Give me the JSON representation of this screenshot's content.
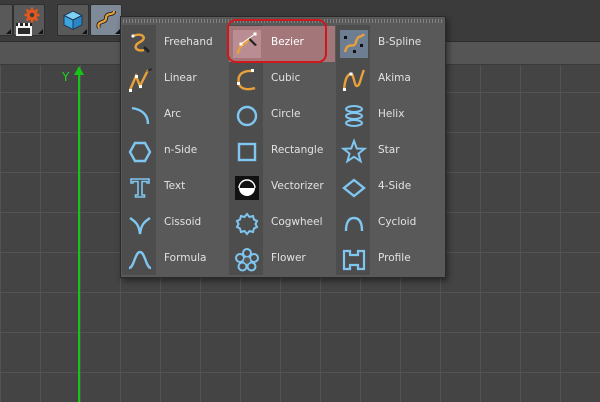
{
  "toolbar": {
    "buttons": [
      {
        "name": "object-tools",
        "icon": "gear-icon"
      },
      {
        "name": "render-settings",
        "icon": "clapperboard-icon"
      },
      {
        "name": "cube-object",
        "icon": "cube-icon"
      },
      {
        "name": "spline-tools",
        "icon": "spline-icon"
      }
    ]
  },
  "viewport": {
    "axis_label": "Y"
  },
  "spline_menu": {
    "highlight_color": "#d0181c",
    "selected_color": "#a3767a",
    "columns": [
      [
        {
          "label": "Freehand",
          "icon": "freehand-icon"
        },
        {
          "label": "Linear",
          "icon": "linear-icon"
        },
        {
          "label": "Arc",
          "icon": "arc-icon"
        },
        {
          "label": "n-Side",
          "icon": "hexagon-icon"
        },
        {
          "label": "Text",
          "icon": "text-icon"
        },
        {
          "label": "Cissoid",
          "icon": "cissoid-icon"
        },
        {
          "label": "Formula",
          "icon": "formula-icon"
        }
      ],
      [
        {
          "label": "Bezier",
          "icon": "bezier-icon",
          "selected": true
        },
        {
          "label": "Cubic",
          "icon": "cubic-icon"
        },
        {
          "label": "Circle",
          "icon": "circle-icon"
        },
        {
          "label": "Rectangle",
          "icon": "rectangle-icon"
        },
        {
          "label": "Vectorizer",
          "icon": "vectorizer-icon"
        },
        {
          "label": "Cogwheel",
          "icon": "cogwheel-icon"
        },
        {
          "label": "Flower",
          "icon": "flower-icon"
        }
      ],
      [
        {
          "label": "B-Spline",
          "icon": "bspline-icon"
        },
        {
          "label": "Akima",
          "icon": "akima-icon"
        },
        {
          "label": "Helix",
          "icon": "helix-icon"
        },
        {
          "label": "Star",
          "icon": "star-icon"
        },
        {
          "label": "4-Side",
          "icon": "diamond-icon"
        },
        {
          "label": "Cycloid",
          "icon": "cycloid-icon"
        },
        {
          "label": "Profile",
          "icon": "profile-icon"
        }
      ]
    ]
  }
}
